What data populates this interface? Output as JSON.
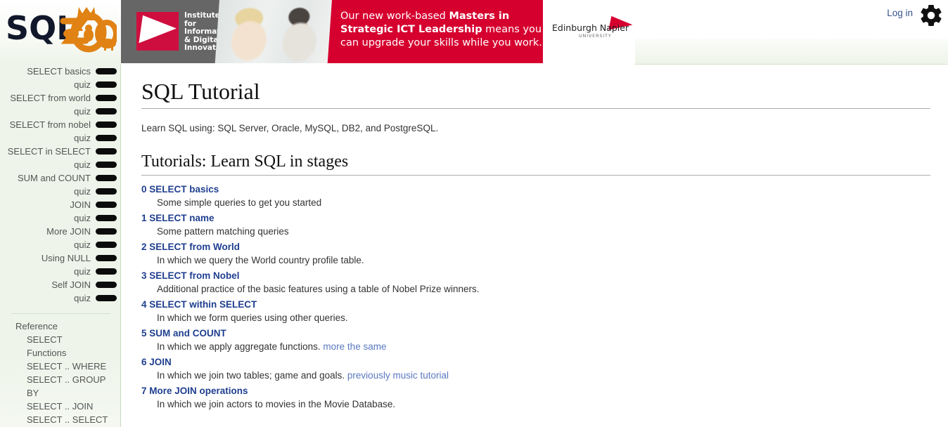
{
  "header": {
    "login_label": "Log in",
    "gear_icon": "gear-icon",
    "banner": {
      "institute_line1": "Institute for",
      "institute_line2": "Informatics",
      "institute_line3": "& Digital",
      "institute_line4": "Innovation",
      "promo_pre": "Our new work-based ",
      "promo_bold1": "Masters in",
      "promo_bold2": "Strategic ICT Leadership",
      "promo_post": " means you can upgrade your skills while you work.",
      "university_name": "Edinburgh Napier",
      "university_sub": "UNIVERSITY"
    },
    "logo_text": "SQLZOO"
  },
  "sidebar": {
    "progress_items": [
      {
        "label": "SELECT basics"
      },
      {
        "label": "quiz"
      },
      {
        "label": "SELECT from world"
      },
      {
        "label": "quiz"
      },
      {
        "label": "SELECT from nobel"
      },
      {
        "label": "quiz"
      },
      {
        "label": "SELECT in SELECT"
      },
      {
        "label": "quiz"
      },
      {
        "label": "SUM and COUNT"
      },
      {
        "label": "quiz"
      },
      {
        "label": "JOIN"
      },
      {
        "label": "quiz"
      },
      {
        "label": "More JOIN"
      },
      {
        "label": "quiz"
      },
      {
        "label": "Using NULL"
      },
      {
        "label": "quiz"
      },
      {
        "label": "Self JOIN"
      },
      {
        "label": "quiz"
      }
    ],
    "reference_title": "Reference",
    "reference_items": [
      {
        "label": "SELECT"
      },
      {
        "label": "Functions"
      },
      {
        "label": "SELECT .. WHERE"
      },
      {
        "label": "SELECT .. GROUP BY"
      },
      {
        "label": "SELECT .. JOIN"
      },
      {
        "label": "SELECT .. SELECT"
      }
    ]
  },
  "main": {
    "title": "SQL Tutorial",
    "intro": "Learn SQL using: SQL Server, Oracle, MySQL, DB2, and PostgreSQL.",
    "section_title": "Tutorials: Learn SQL in stages",
    "tutorials": [
      {
        "link": "0 SELECT basics",
        "desc": "Some simple queries to get you started",
        "extra_link": ""
      },
      {
        "link": "1 SELECT name",
        "desc": "Some pattern matching queries",
        "extra_link": ""
      },
      {
        "link": "2 SELECT from World",
        "desc": "In which we query the World country profile table.",
        "extra_link": ""
      },
      {
        "link": "3 SELECT from Nobel",
        "desc": "Additional practice of the basic features using a table of Nobel Prize winners.",
        "extra_link": ""
      },
      {
        "link": "4 SELECT within SELECT",
        "desc": "In which we form queries using other queries.",
        "extra_link": ""
      },
      {
        "link": "5 SUM and COUNT",
        "desc": "In which we apply aggregate functions.",
        "extra_link": "more the same"
      },
      {
        "link": "6 JOIN",
        "desc": "In which we join two tables; game and goals.",
        "extra_link": "previously music tutorial"
      },
      {
        "link": "7 More JOIN operations",
        "desc": "In which we join actors to movies in the Movie Database.",
        "extra_link": ""
      }
    ]
  },
  "colors": {
    "link_blue": "#1f3f8f",
    "inline_link_blue": "#5a79c0",
    "brand_red": "#d6002f",
    "sidebar_green": "#eef4e9",
    "logo_orange": "#e08214"
  }
}
